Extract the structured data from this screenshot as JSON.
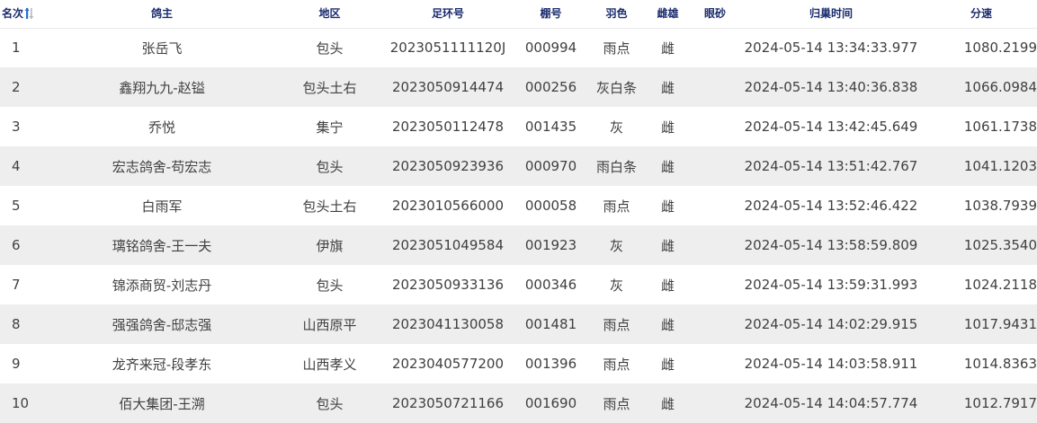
{
  "table": {
    "columns": [
      {
        "key": "rank",
        "label": "名次"
      },
      {
        "key": "owner",
        "label": "鸽主"
      },
      {
        "key": "region",
        "label": "地区"
      },
      {
        "key": "ring",
        "label": "足环号"
      },
      {
        "key": "shed",
        "label": "棚号"
      },
      {
        "key": "color",
        "label": "羽色"
      },
      {
        "key": "sex",
        "label": "雌雄"
      },
      {
        "key": "eye",
        "label": "眼砂"
      },
      {
        "key": "time",
        "label": "归巢时间"
      },
      {
        "key": "speed",
        "label": "分速"
      }
    ],
    "sort_icon": "sort-arrows-icon",
    "rows": [
      {
        "rank": "1",
        "owner": "张岳飞",
        "region": "包头",
        "ring": "2023051111120J",
        "shed": "000994",
        "color": "雨点",
        "sex": "雌",
        "eye": "",
        "time": "2024-05-14 13:34:33.977",
        "speed": "1080.2199"
      },
      {
        "rank": "2",
        "owner": "鑫翔九九-赵镒",
        "region": "包头土右",
        "ring": "2023050914474",
        "shed": "000256",
        "color": "灰白条",
        "sex": "雌",
        "eye": "",
        "time": "2024-05-14 13:40:36.838",
        "speed": "1066.0984"
      },
      {
        "rank": "3",
        "owner": "乔悦",
        "region": "集宁",
        "ring": "2023050112478",
        "shed": "001435",
        "color": "灰",
        "sex": "雌",
        "eye": "",
        "time": "2024-05-14 13:42:45.649",
        "speed": "1061.1738"
      },
      {
        "rank": "4",
        "owner": "宏志鸽舍-苟宏志",
        "region": "包头",
        "ring": "2023050923936",
        "shed": "000970",
        "color": "雨白条",
        "sex": "雌",
        "eye": "",
        "time": "2024-05-14 13:51:42.767",
        "speed": "1041.1203"
      },
      {
        "rank": "5",
        "owner": "白雨军",
        "region": "包头土右",
        "ring": "2023010566000",
        "shed": "000058",
        "color": "雨点",
        "sex": "雌",
        "eye": "",
        "time": "2024-05-14 13:52:46.422",
        "speed": "1038.7939"
      },
      {
        "rank": "6",
        "owner": "璃铭鸽舍-王一夫",
        "region": "伊旗",
        "ring": "2023051049584",
        "shed": "001923",
        "color": "灰",
        "sex": "雌",
        "eye": "",
        "time": "2024-05-14 13:58:59.809",
        "speed": "1025.3540"
      },
      {
        "rank": "7",
        "owner": "锦添商贸-刘志丹",
        "region": "包头",
        "ring": "2023050933136",
        "shed": "000346",
        "color": "灰",
        "sex": "雌",
        "eye": "",
        "time": "2024-05-14 13:59:31.993",
        "speed": "1024.2118"
      },
      {
        "rank": "8",
        "owner": "强强鸽舍-邸志强",
        "region": "山西原平",
        "ring": "2023041130058",
        "shed": "001481",
        "color": "雨点",
        "sex": "雌",
        "eye": "",
        "time": "2024-05-14 14:02:29.915",
        "speed": "1017.9431"
      },
      {
        "rank": "9",
        "owner": "龙齐来冠-段孝东",
        "region": "山西孝义",
        "ring": "2023040577200",
        "shed": "001396",
        "color": "雨点",
        "sex": "雌",
        "eye": "",
        "time": "2024-05-14 14:03:58.911",
        "speed": "1014.8363"
      },
      {
        "rank": "10",
        "owner": "佰大集团-王溯",
        "region": "包头",
        "ring": "2023050721166",
        "shed": "001690",
        "color": "雨点",
        "sex": "雌",
        "eye": "",
        "time": "2024-05-14 14:04:57.774",
        "speed": "1012.7917"
      }
    ]
  }
}
